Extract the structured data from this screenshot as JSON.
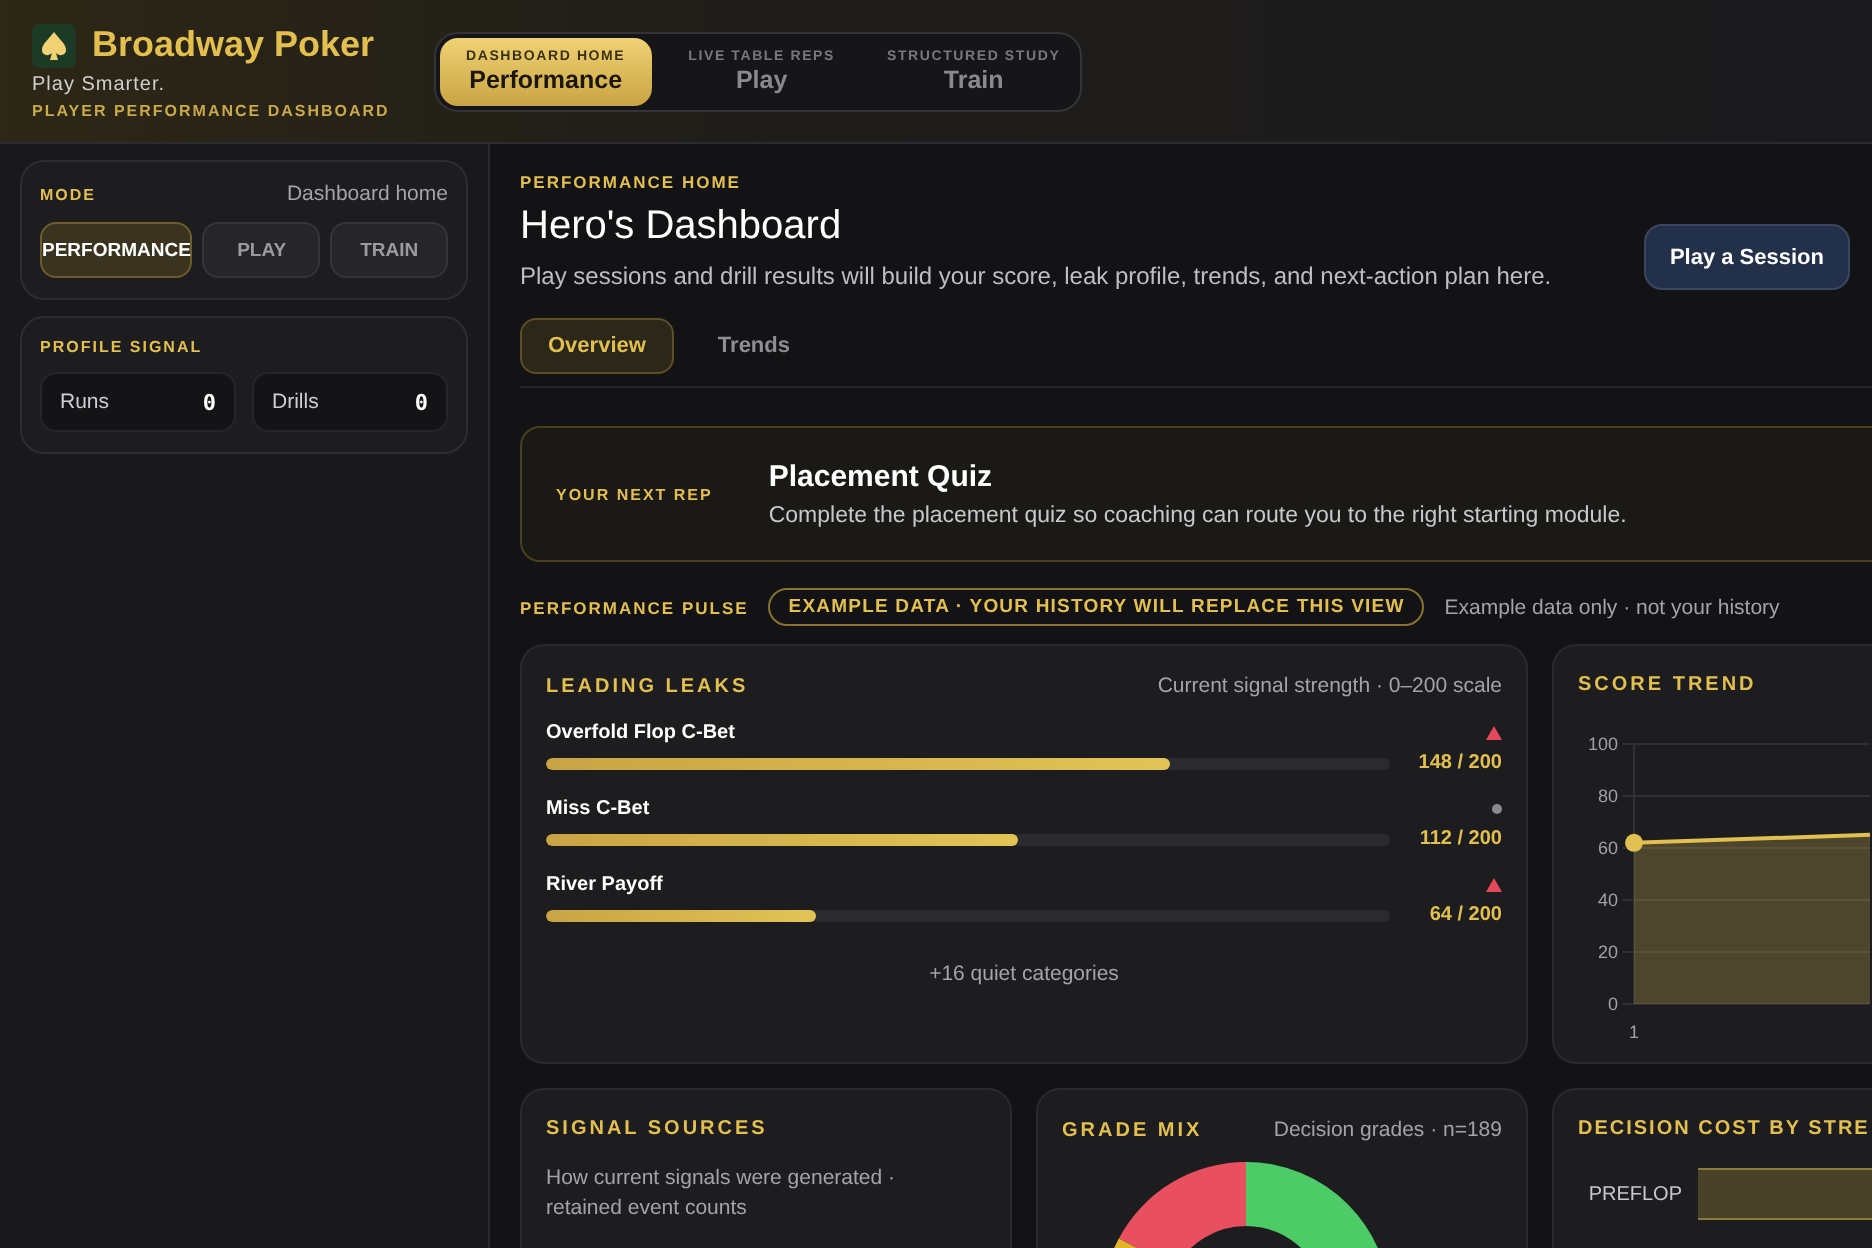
{
  "brand": {
    "name": "Broadway Poker",
    "tagline": "Play Smarter.",
    "subtitle": "PLAYER PERFORMANCE DASHBOARD"
  },
  "top_nav": [
    {
      "eyebrow": "DASHBOARD HOME",
      "label": "Performance",
      "selected": true
    },
    {
      "eyebrow": "LIVE TABLE REPS",
      "label": "Play",
      "selected": false
    },
    {
      "eyebrow": "STRUCTURED STUDY",
      "label": "Train",
      "selected": false
    }
  ],
  "sidebar": {
    "mode": {
      "title": "MODE",
      "value": "Dashboard home",
      "options": [
        {
          "label": "PERFORMANCE",
          "selected": true
        },
        {
          "label": "PLAY",
          "selected": false
        },
        {
          "label": "TRAIN",
          "selected": false
        }
      ]
    },
    "profile_signal": {
      "title": "PROFILE SIGNAL",
      "stats": [
        {
          "label": "Runs",
          "value": "0"
        },
        {
          "label": "Drills",
          "value": "0"
        }
      ]
    }
  },
  "page": {
    "eyebrow": "PERFORMANCE HOME",
    "title": "Hero's Dashboard",
    "description": "Play sessions and drill results will build your score, leak profile, trends, and next-action plan here.",
    "action": "Play a Session"
  },
  "tabs": [
    {
      "label": "Overview",
      "selected": true
    },
    {
      "label": "Trends",
      "selected": false
    }
  ],
  "next_rep": {
    "eyebrow": "YOUR NEXT REP",
    "title": "Placement Quiz",
    "text": "Complete the placement quiz so coaching can route you to the right starting module."
  },
  "pulse": {
    "title": "PERFORMANCE PULSE",
    "badge": "EXAMPLE DATA · YOUR HISTORY WILL REPLACE THIS VIEW",
    "note": "Example data only · not your history"
  },
  "leading_leaks": {
    "title": "LEADING LEAKS",
    "subtitle": "Current signal strength · 0–200 scale",
    "footer": "+16 quiet categories",
    "items": [
      {
        "name": "Overfold Flop C-Bet",
        "level": 0.74,
        "reading": "148 / 200",
        "kind": "up"
      },
      {
        "name": "Miss C-Bet",
        "level": 0.56,
        "reading": "112 / 200",
        "kind": "flat"
      },
      {
        "name": "River Payoff",
        "level": 0.32,
        "reading": "64 / 200",
        "kind": "up"
      }
    ]
  },
  "score_trend": {
    "title": "SCORE TREND",
    "y_labels": [
      "100",
      "80",
      "60",
      "40",
      "20",
      "0"
    ],
    "x_labels": [
      "1"
    ]
  },
  "signal_sources": {
    "title": "SIGNAL SOURCES",
    "text": "How current signals were generated · retained event counts"
  },
  "grade_mix": {
    "title": "GRADE MIX",
    "subtitle": "Decision grades · n=189"
  },
  "decision_cost": {
    "title": "DECISION COST BY STRE",
    "rows": [
      {
        "label": "PREFLOP"
      }
    ]
  }
}
